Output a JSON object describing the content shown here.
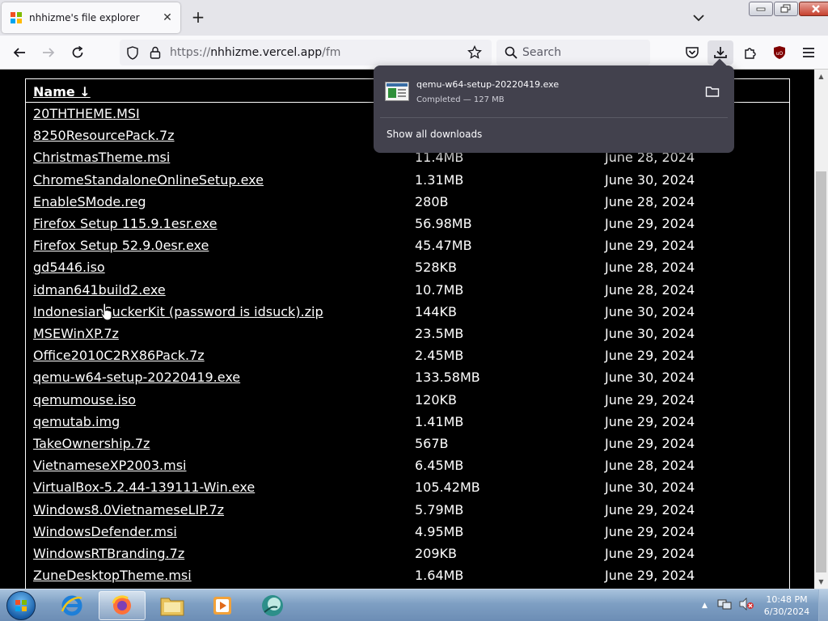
{
  "tab": {
    "title": "nhhizme's file explorer"
  },
  "navbar": {
    "url_prefix": "https://",
    "url_host": "nhhizme.vercel.app",
    "url_path": "/fm",
    "search_placeholder": "Search"
  },
  "table": {
    "name_header": "Name ↓",
    "rows": [
      {
        "name": "20THTHEME.MSI",
        "size": "",
        "date": ""
      },
      {
        "name": "8250ResourcePack.7z",
        "size": "",
        "date": ""
      },
      {
        "name": "ChristmasTheme.msi",
        "size": "11.4MB",
        "date": "June 28, 2024"
      },
      {
        "name": "ChromeStandaloneOnlineSetup.exe",
        "size": "1.31MB",
        "date": "June 30, 2024"
      },
      {
        "name": "EnableSMode.reg",
        "size": "280B",
        "date": "June 28, 2024"
      },
      {
        "name": "Firefox Setup 115.9.1esr.exe",
        "size": "56.98MB",
        "date": "June 29, 2024"
      },
      {
        "name": "Firefox Setup 52.9.0esr.exe",
        "size": "45.47MB",
        "date": "June 29, 2024"
      },
      {
        "name": "gd5446.iso",
        "size": "528KB",
        "date": "June 28, 2024"
      },
      {
        "name": "idman641build2.exe",
        "size": "10.7MB",
        "date": "June 28, 2024"
      },
      {
        "name": "IndonesianSuckerKit (password is idsuck).zip",
        "size": "144KB",
        "date": "June 30, 2024"
      },
      {
        "name": "MSEWinXP.7z",
        "size": "23.5MB",
        "date": "June 30, 2024"
      },
      {
        "name": "Office2010C2RX86Pack.7z",
        "size": "2.45MB",
        "date": "June 29, 2024"
      },
      {
        "name": "qemu-w64-setup-20220419.exe",
        "size": "133.58MB",
        "date": "June 30, 2024"
      },
      {
        "name": "qemumouse.iso",
        "size": "120KB",
        "date": "June 29, 2024"
      },
      {
        "name": "qemutab.img",
        "size": "1.41MB",
        "date": "June 29, 2024"
      },
      {
        "name": "TakeOwnership.7z",
        "size": "567B",
        "date": "June 29, 2024"
      },
      {
        "name": "VietnameseXP2003.msi",
        "size": "6.45MB",
        "date": "June 28, 2024"
      },
      {
        "name": "VirtualBox-5.2.44-139111-Win.exe",
        "size": "105.42MB",
        "date": "June 30, 2024"
      },
      {
        "name": "Windows8.0VietnameseLIP.7z",
        "size": "5.79MB",
        "date": "June 29, 2024"
      },
      {
        "name": "WindowsDefender.msi",
        "size": "4.95MB",
        "date": "June 29, 2024"
      },
      {
        "name": "WindowsRTBranding.7z",
        "size": "209KB",
        "date": "June 29, 2024"
      },
      {
        "name": "ZuneDesktopTheme.msi",
        "size": "1.64MB",
        "date": "June 29, 2024"
      }
    ]
  },
  "downloads": {
    "filename": "qemu-w64-setup-20220419.exe",
    "status": "Completed — 127 MB",
    "show_all": "Show all downloads"
  },
  "taskbar": {
    "items": [
      "internet-explorer",
      "firefox",
      "file-explorer",
      "media-player",
      "app"
    ],
    "time": "10:48 PM",
    "date": "6/30/2024"
  },
  "colors": {
    "page_bg": "#000000",
    "text": "#ffffff",
    "panel_bg": "#42414d",
    "chrome_bg": "#f9f9fb"
  }
}
